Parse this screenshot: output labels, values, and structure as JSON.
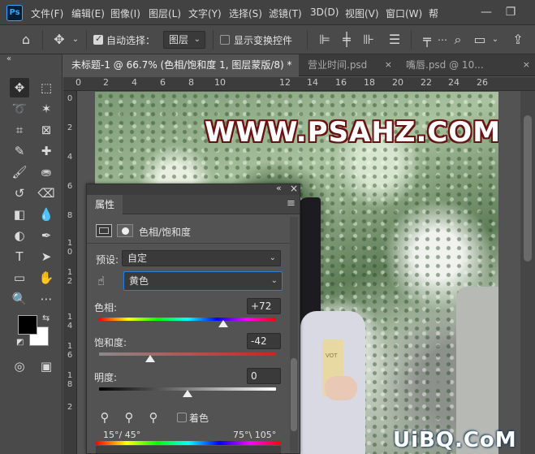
{
  "app": {
    "logo": "Ps"
  },
  "menu": [
    "文件(F)",
    "编辑(E)",
    "图像(I)",
    "图层(L)",
    "文字(Y)",
    "选择(S)",
    "滤镜(T)",
    "3D(D)",
    "视图(V)",
    "窗口(W)",
    "帮"
  ],
  "window_controls": {
    "minimize": "—",
    "restore": "❐"
  },
  "options": {
    "auto_select_label": "自动选择：",
    "auto_select_checked": true,
    "auto_select_value": "图层",
    "show_transform_label": "显示变换控件",
    "show_transform_checked": false
  },
  "tabs": [
    {
      "label": "未标题-1 @ 66.7% (色相/饱和度 1, 图层蒙版/8) *",
      "active": true
    },
    {
      "label": "营业时间.psd",
      "active": false
    },
    {
      "label": "嘴唇.psd @ 10...",
      "active": false
    }
  ],
  "tab_close": "×",
  "ruler_top": [
    "0",
    "2",
    "4",
    "6",
    "8",
    "10",
    "12",
    "14",
    "16",
    "18",
    "20",
    "22",
    "24",
    "26"
  ],
  "ruler_left": [
    {
      "digits": [
        "0"
      ]
    },
    {
      "digits": [
        "2"
      ]
    },
    {
      "digits": [
        "4"
      ]
    },
    {
      "digits": [
        "6"
      ]
    },
    {
      "digits": [
        "8"
      ]
    },
    {
      "digits": [
        "1",
        "0"
      ]
    },
    {
      "digits": [
        "1",
        "2"
      ]
    },
    {
      "digits": [
        "1",
        "4"
      ]
    },
    {
      "digits": [
        "1",
        "6"
      ]
    },
    {
      "digits": [
        "1",
        "8"
      ]
    },
    {
      "digits": [
        "2"
      ]
    }
  ],
  "canvas": {
    "watermark": "WWW.PSAHZ.COM",
    "cup_text": "VOT"
  },
  "panel": {
    "tab_label": "属性",
    "collapse": "«",
    "close": "×",
    "menu": "≡",
    "title": "色相/饱和度",
    "preset_label": "预设:",
    "preset_value": "自定",
    "channel_value": "黄色",
    "hue_label": "色相:",
    "hue_value": "+72",
    "hue_fraction": 0.7,
    "sat_label": "饱和度:",
    "sat_value": "-42",
    "sat_fraction": 0.29,
    "light_label": "明度:",
    "light_value": "0",
    "light_fraction": 0.5,
    "colorize_label": "着色",
    "colorize_checked": false,
    "range_left": "15°/ 45°",
    "range_right": "75°\\ 105°"
  },
  "site_mark": "UiBQ.CoM",
  "colors": {
    "accent": "#31a8ff",
    "panel_bg": "#535353",
    "select_focus": "#2d7fd6",
    "watermark_outline": "#6a1212"
  }
}
